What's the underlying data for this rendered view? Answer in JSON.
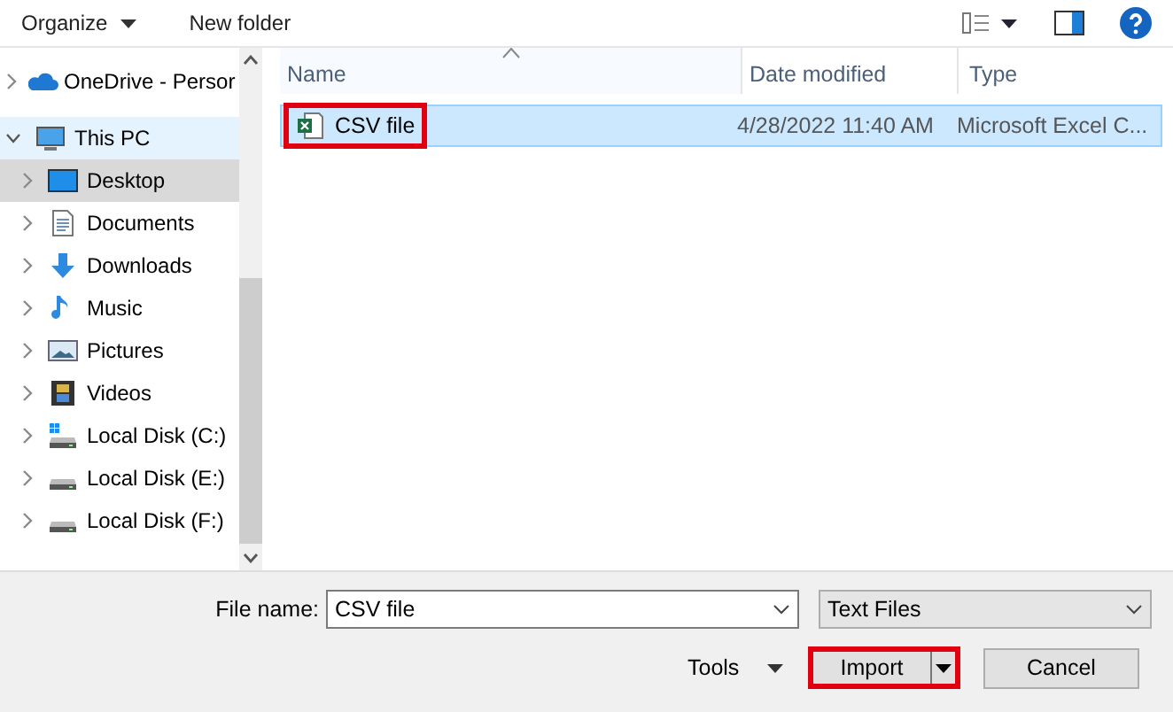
{
  "toolbar": {
    "organize": "Organize",
    "new_folder": "New folder"
  },
  "nav": {
    "items": [
      {
        "label": "OneDrive - Persor",
        "kind": "cloud",
        "expanded": false,
        "selected": false,
        "hovered": false
      },
      {
        "label": "This PC",
        "kind": "pc",
        "expanded": true,
        "selected": false,
        "hovered": true,
        "children": [
          {
            "label": "Desktop",
            "kind": "desktop",
            "expanded": false,
            "selected": true,
            "hovered": false
          },
          {
            "label": "Documents",
            "kind": "documents",
            "expanded": false,
            "selected": false,
            "hovered": false
          },
          {
            "label": "Downloads",
            "kind": "downloads",
            "expanded": false,
            "selected": false,
            "hovered": false
          },
          {
            "label": "Music",
            "kind": "music",
            "expanded": false,
            "selected": false,
            "hovered": false
          },
          {
            "label": "Pictures",
            "kind": "pictures",
            "expanded": false,
            "selected": false,
            "hovered": false
          },
          {
            "label": "Videos",
            "kind": "videos",
            "expanded": false,
            "selected": false,
            "hovered": false
          },
          {
            "label": "Local Disk (C:)",
            "kind": "system-disk",
            "expanded": false,
            "selected": false,
            "hovered": false
          },
          {
            "label": "Local Disk (E:)",
            "kind": "disk",
            "expanded": false,
            "selected": false,
            "hovered": false
          },
          {
            "label": "Local Disk (F:)",
            "kind": "disk",
            "expanded": false,
            "selected": false,
            "hovered": false
          }
        ]
      }
    ]
  },
  "file_list": {
    "columns": [
      {
        "label": "Name",
        "sorted": true
      },
      {
        "label": "Date modified",
        "sorted": false
      },
      {
        "label": "Type",
        "sorted": false
      }
    ],
    "rows": [
      {
        "name": "CSV file",
        "date_modified": "4/28/2022 11:40 AM",
        "type": "Microsoft Excel C...",
        "selected": true,
        "highlighted": true
      }
    ]
  },
  "footer": {
    "file_name_label": "File name:",
    "file_name": "CSV file",
    "file_type": "Text Files",
    "tools": "Tools",
    "import": {
      "label": "Import",
      "highlighted": true
    },
    "cancel": "Cancel"
  }
}
